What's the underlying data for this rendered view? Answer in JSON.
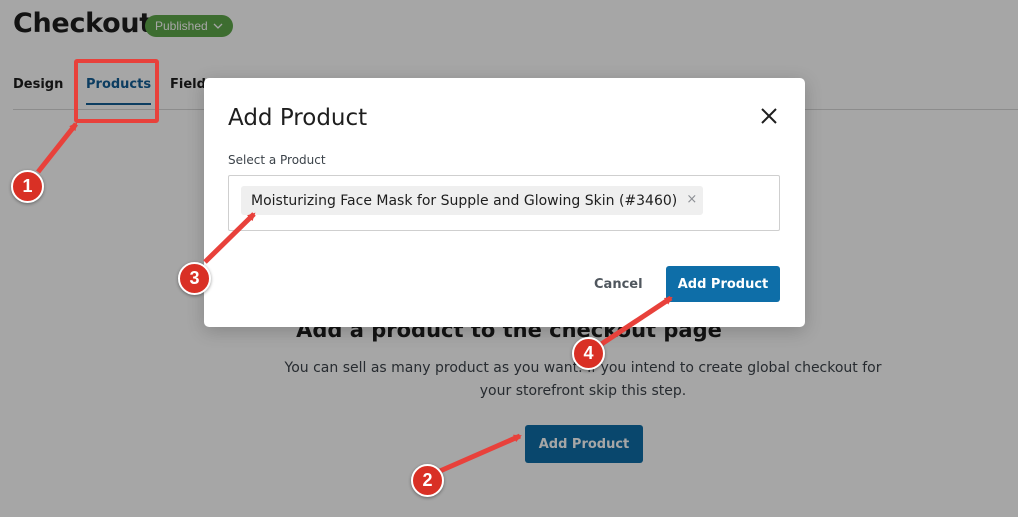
{
  "page": {
    "title": "Checkout",
    "status": "Published",
    "tabs": [
      {
        "label": "Design"
      },
      {
        "label": "Products"
      },
      {
        "label": "Fields"
      }
    ],
    "empty_state": {
      "heading": "Add a product to the checkout page",
      "text": "You can sell as many product as you want. If you intend to create global checkout for your storefront skip this step.",
      "button": "Add Product"
    }
  },
  "modal": {
    "title": "Add Product",
    "field_label": "Select a Product",
    "selected_product": "Moisturizing Face Mask for Supple and Glowing Skin (#3460)",
    "remove_glyph": "×",
    "cancel": "Cancel",
    "submit": "Add Product"
  },
  "annotations": {
    "markers": [
      "1",
      "2",
      "3",
      "4"
    ],
    "color": "#e8413b"
  },
  "colors": {
    "primary": "#0e6ea8",
    "badge": "#5fa84a",
    "tab_active": "#135e96"
  }
}
